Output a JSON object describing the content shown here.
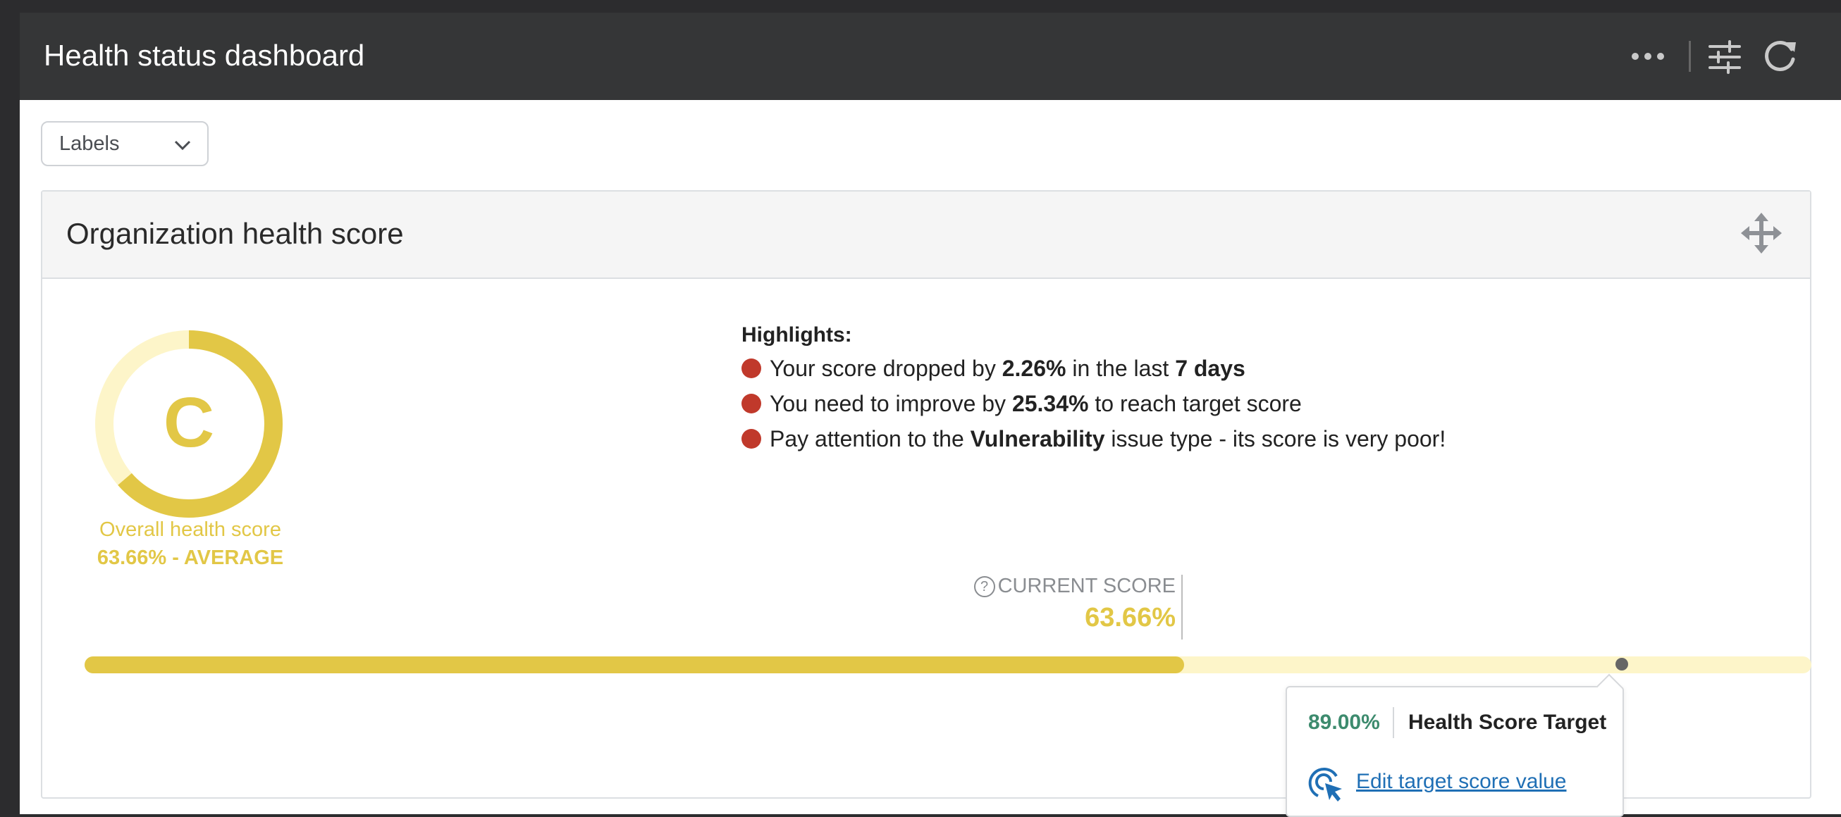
{
  "header": {
    "title": "Health status dashboard",
    "icons": [
      "more-icon",
      "filter-icon",
      "refresh-icon"
    ]
  },
  "filters": {
    "labels_select": "Labels"
  },
  "panel": {
    "title": "Organization health score",
    "grade": "C",
    "overall_label": "Overall health score",
    "overall_value": "63.66% - AVERAGE",
    "score_fraction": 0.6366,
    "colors": {
      "score": "#e2c746",
      "score_light": "#fdf5c9",
      "alert": "#c0392b",
      "target": "#3d8b6e",
      "link": "#1f6fb5"
    }
  },
  "highlights": {
    "title": "Highlights:",
    "items": [
      {
        "a": "Your score dropped by ",
        "b": "2.26%",
        "c": " in the last ",
        "d": "7 days",
        "e": ""
      },
      {
        "a": "You need to improve by ",
        "b": "25.34%",
        "c": " to reach target score",
        "d": "",
        "e": ""
      },
      {
        "a": "Pay attention to the ",
        "b": "Vulnerability",
        "c": " issue type - its score is very poor!",
        "d": "",
        "e": ""
      }
    ]
  },
  "progress": {
    "current_label": "CURRENT SCORE",
    "current_value": "63.66%",
    "current_fraction": 0.6366,
    "target_fraction": 0.89
  },
  "target_popover": {
    "value": "89.00%",
    "label": "Health Score Target",
    "edit_link": "Edit target score value"
  }
}
